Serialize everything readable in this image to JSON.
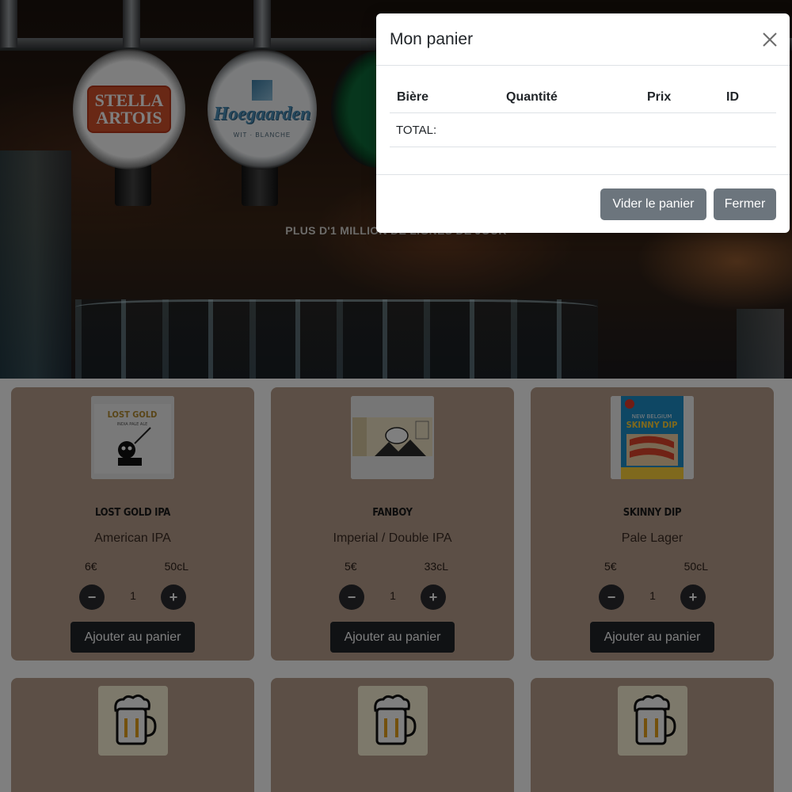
{
  "hero": {
    "tap_labels": {
      "stella": [
        "STELLA",
        "ARTOIS"
      ],
      "hoegaarden": "Hoegaarden",
      "hoegaarden_sub": "WIT · BLANCHE"
    },
    "subtitle": "PLUS D'1 MILLION DE LIGNES DE JOUR"
  },
  "products": [
    {
      "name": "LOST GOLD IPA",
      "style": "American IPA",
      "price": "6€",
      "volume": "50cL",
      "quantity": "1",
      "add_label": "Ajouter au panier",
      "image": "lost-gold-can"
    },
    {
      "name": "FANBOY",
      "style": "Imperial / Double IPA",
      "price": "5€",
      "volume": "33cL",
      "quantity": "1",
      "add_label": "Ajouter au panier",
      "image": "fanboy-label"
    },
    {
      "name": "SKINNY DIP",
      "style": "Pale Lager",
      "price": "5€",
      "volume": "50cL",
      "quantity": "1",
      "add_label": "Ajouter au panier",
      "image": "skinny-dip-label"
    },
    {
      "image": "beer-mug-icon"
    },
    {
      "image": "beer-mug-icon"
    },
    {
      "image": "beer-mug-icon"
    }
  ],
  "controls": {
    "minus": "−",
    "plus": "+"
  },
  "modal": {
    "title": "Mon panier",
    "columns": [
      "Bière",
      "Quantité",
      "Prix",
      "ID"
    ],
    "total_label": "TOTAL:",
    "clear_button": "Vider le panier",
    "close_button": "Fermer"
  },
  "colors": {
    "card": "#b89f8d",
    "button_dark": "#212529",
    "button_secondary": "#6c757d"
  }
}
